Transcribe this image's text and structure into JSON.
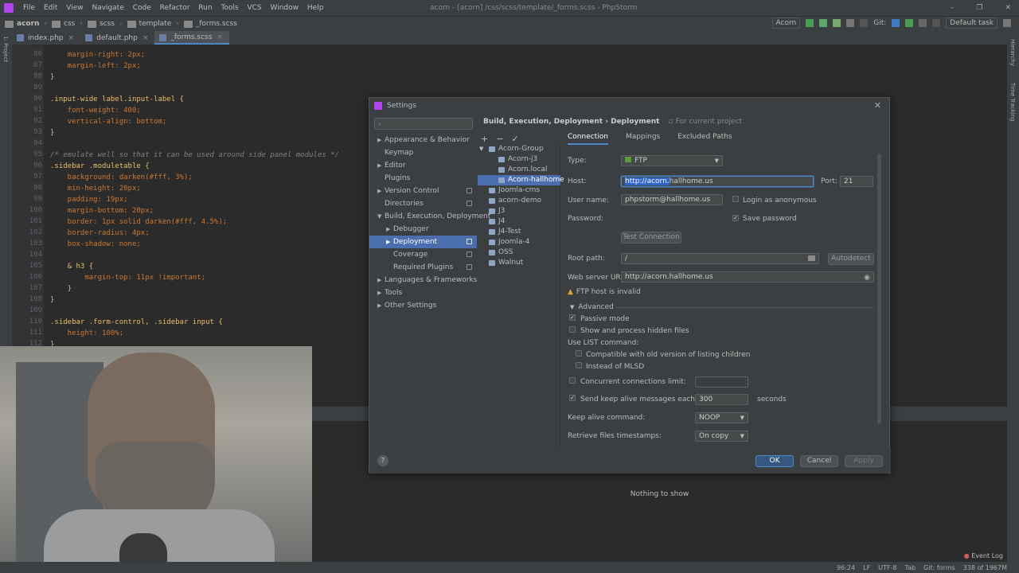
{
  "menu": [
    "File",
    "Edit",
    "View",
    "Navigate",
    "Code",
    "Refactor",
    "Run",
    "Tools",
    "VCS",
    "Window",
    "Help"
  ],
  "window_title": "acorn - [acorn] /css/scss/template/_forms.scss - PhpStorm",
  "breadcrumbs": [
    "acorn",
    "css",
    "scss",
    "template",
    "_forms.scss"
  ],
  "run_config": "Acorn",
  "git_label": "Git:",
  "task": "Default task",
  "tabs": [
    "index.php",
    "default.php",
    "_forms.scss"
  ],
  "left_strip": "1: Project",
  "right_strip": [
    "Hierarchy",
    "Time Tracking"
  ],
  "code": [
    {
      "n": "86",
      "t": "    margin-right: 2px;"
    },
    {
      "n": "87",
      "t": "    margin-left: 2px;"
    },
    {
      "n": "88",
      "t": "}"
    },
    {
      "n": "89",
      "t": ""
    },
    {
      "n": "90",
      "t": ".input-wide label.input-label {"
    },
    {
      "n": "91",
      "t": "    font-weight: 400;"
    },
    {
      "n": "92",
      "t": "    vertical-align: bottom;"
    },
    {
      "n": "93",
      "t": "}"
    },
    {
      "n": "94",
      "t": ""
    },
    {
      "n": "95",
      "t": "/* emulate well so that it can be used around side panel modules */"
    },
    {
      "n": "96",
      "t": ".sidebar .moduletable {"
    },
    {
      "n": "97",
      "t": "    background: darken(#fff, 3%);"
    },
    {
      "n": "98",
      "t": "    min-height: 20px;"
    },
    {
      "n": "99",
      "t": "    padding: 19px;"
    },
    {
      "n": "100",
      "t": "    margin-bottom: 20px;"
    },
    {
      "n": "101",
      "t": "    border: 1px solid darken(#fff, 4.5%);"
    },
    {
      "n": "102",
      "t": "    border-radius: 4px;"
    },
    {
      "n": "103",
      "t": "    box-shadow: none;"
    },
    {
      "n": "104",
      "t": ""
    },
    {
      "n": "105",
      "t": "    & h3 {"
    },
    {
      "n": "106",
      "t": "        margin-top: 11px !important;"
    },
    {
      "n": "107",
      "t": "    }"
    },
    {
      "n": "108",
      "t": "}"
    },
    {
      "n": "109",
      "t": ""
    },
    {
      "n": "110",
      "t": ".sidebar .form-control, .sidebar input {"
    },
    {
      "n": "111",
      "t": "    height: 100%;"
    },
    {
      "n": "112",
      "t": "}"
    }
  ],
  "dialog": {
    "title": "Settings",
    "breadcrumb": "Build, Execution, Deployment",
    "breadcrumb_sep": "›",
    "breadcrumb_leaf": "Deployment",
    "for_project": "For current project",
    "nav": [
      "Appearance & Behavior",
      "Keymap",
      "Editor",
      "Plugins",
      "Version Control",
      "Directories",
      "Build, Execution, Deployment",
      "Debugger",
      "Deployment",
      "Coverage",
      "Required Plugins",
      "Languages & Frameworks",
      "Tools",
      "Other Settings"
    ],
    "servers": [
      "Acorn-Group",
      "Acorn-j3",
      "Acorn.local",
      "Acorn-hallhome",
      "Joomla-cms",
      "acorn-demo",
      "J3",
      "J4",
      "J4-Test",
      "Joomla-4",
      "OSS",
      "Walnut"
    ],
    "tabs": [
      "Connection",
      "Mappings",
      "Excluded Paths"
    ],
    "type_label": "Type:",
    "type_value": "FTP",
    "host_label": "Host:",
    "host_sel": "http://acorn.",
    "host_rest": "hallhome.us",
    "port_label": "Port:",
    "port_value": "21",
    "user_label": "User name:",
    "user_value": "phpstorm@hallhome.us",
    "anon_label": "Login as anonymous",
    "pass_label": "Password:",
    "save_pass": "Save password",
    "test_btn": "Test Connection",
    "root_label": "Root path:",
    "root_value": "/",
    "autodetect": "Autodetect",
    "weburl_label": "Web server URL:",
    "weburl_value": "http://acorn.hallhome.us",
    "warning": "FTP host is invalid",
    "advanced": "Advanced",
    "passive": "Passive mode",
    "hidden": "Show and process hidden files",
    "list_label": "Use  LIST command:",
    "compat": "Compatible with old version of listing children",
    "mlsd": "Instead of MLSD",
    "concurrent": "Concurrent connections limit:",
    "keepalive": "Send keep alive messages each:",
    "keepalive_value": "300",
    "seconds": "seconds",
    "keepcmd_label": "Keep alive command:",
    "keepcmd_value": "NOOP",
    "timestamps_label": "Retrieve files timestamps:",
    "timestamps_value": "On copy",
    "ok": "OK",
    "cancel": "Cancel",
    "apply": "Apply",
    "help": "?"
  },
  "nothing": "Nothing to show",
  "event_log": "Event Log",
  "status": [
    "96:24",
    "LF",
    "UTF-8",
    "Tab",
    "Git: forms",
    "338 of 1967M"
  ]
}
